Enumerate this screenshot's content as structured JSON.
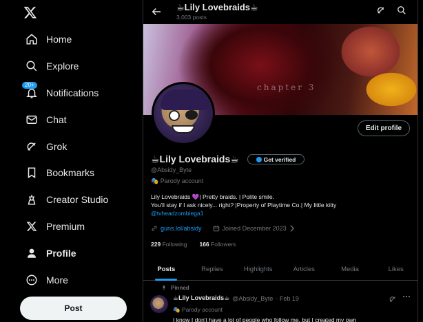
{
  "nav": {
    "items": [
      {
        "label": "Home",
        "icon": "home-icon"
      },
      {
        "label": "Explore",
        "icon": "search-icon"
      },
      {
        "label": "Notifications",
        "icon": "bell-icon",
        "badge": "20+"
      },
      {
        "label": "Chat",
        "icon": "mail-icon"
      },
      {
        "label": "Grok",
        "icon": "grok-icon"
      },
      {
        "label": "Bookmarks",
        "icon": "bookmark-icon"
      },
      {
        "label": "Creator Studio",
        "icon": "creator-icon"
      },
      {
        "label": "Premium",
        "icon": "x-icon"
      },
      {
        "label": "Profile",
        "icon": "person-icon"
      },
      {
        "label": "More",
        "icon": "more-icon"
      }
    ],
    "post_label": "Post"
  },
  "header": {
    "name": "☕Lily Lovebraids☕",
    "post_count": "3,003 posts"
  },
  "banner": {
    "text": "chapter 3"
  },
  "profile": {
    "edit_label": "Edit profile",
    "name": "☕Lily Lovebraids☕",
    "verify_label": "Get verified",
    "handle": "@Absidy_Byte",
    "parody_label": "🎭 Parody account",
    "bio_line1": "Lily Lovebraids 💜| Pretty braids. | Polite smile.",
    "bio_line2": "You'll stay if I ask nicely... right? |Property of Playtime Co.| My little kitty",
    "bio_link": "@tvheadzombiega1",
    "website": "guns.lol/absidy",
    "joined": "Joined December 2023",
    "following_count": "229",
    "following_label": "Following",
    "followers_count": "166",
    "followers_label": "Followers"
  },
  "tabs": [
    "Posts",
    "Replies",
    "Highlights",
    "Articles",
    "Media",
    "Likes"
  ],
  "tweet": {
    "pinned_label": "Pinned",
    "name": "☕Lily Lovebraids☕",
    "handle": "@Absidy_Byte",
    "date": "· Feb 19",
    "parody_label": "🎭 Parody account",
    "text": "I know I don't have a lot of people who follow me, but I created my own"
  },
  "colors": {
    "accent": "#1d9bf0",
    "background": "#000000",
    "muted": "#71767b"
  }
}
